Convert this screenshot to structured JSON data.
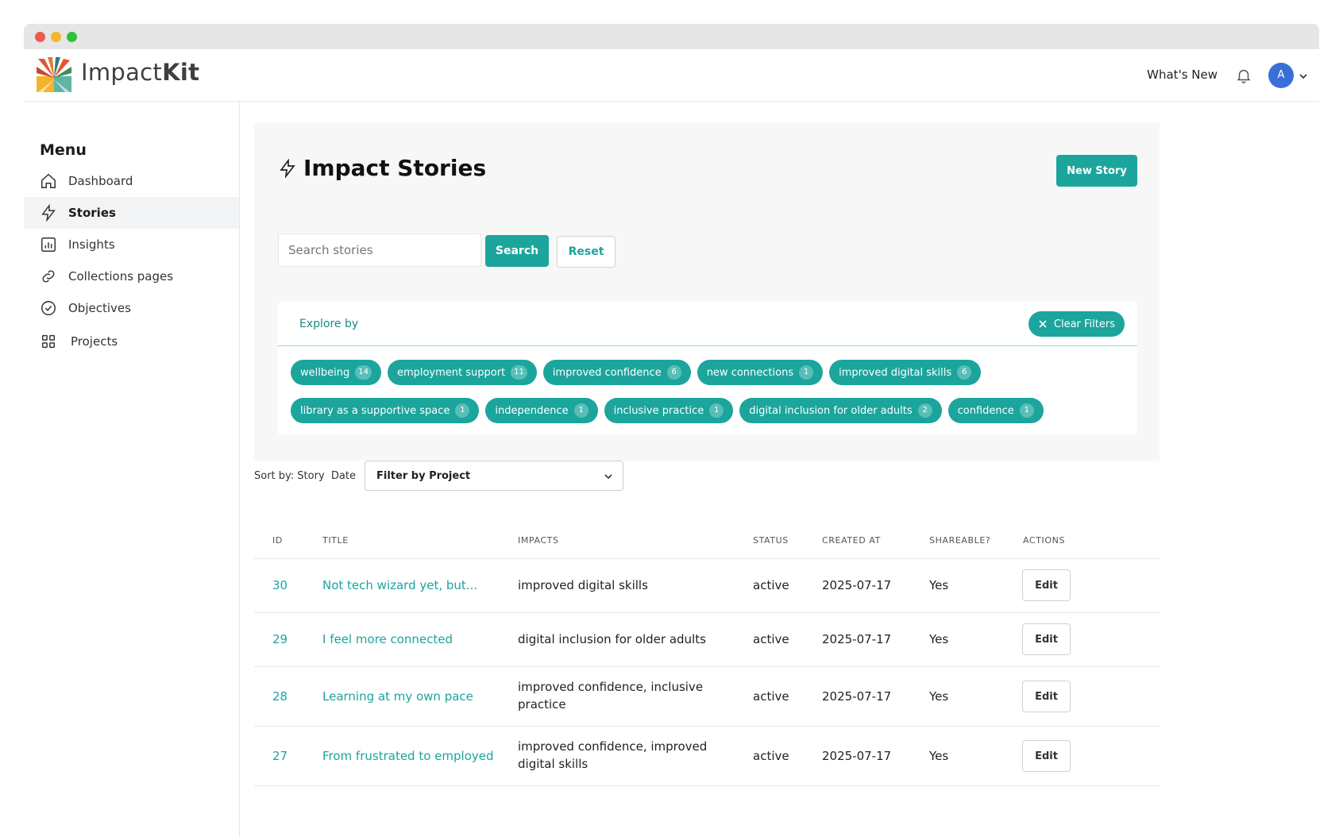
{
  "brand": {
    "name_light": "Impact",
    "name_bold": "Kit"
  },
  "header": {
    "whats_new": "What's New",
    "avatar_initials": "A"
  },
  "sidebar": {
    "title": "Menu",
    "items": [
      {
        "label": "Dashboard",
        "icon": "home-icon"
      },
      {
        "label": "Stories",
        "icon": "lightning-icon",
        "active": true
      },
      {
        "label": "Insights",
        "icon": "chart-icon"
      },
      {
        "label": "Collections pages",
        "icon": "link-icon"
      },
      {
        "label": "Objectives",
        "icon": "check-circle-icon"
      },
      {
        "label": "Projects",
        "icon": "grid-icon"
      }
    ]
  },
  "main": {
    "title": "Impact Stories",
    "new_story_label": "New Story",
    "search": {
      "placeholder": "Search stories",
      "button": "Search",
      "reset": "Reset"
    },
    "explore": {
      "label": "Explore by",
      "clear_label": "Clear Filters",
      "tags": [
        {
          "label": "wellbeing",
          "count": "14"
        },
        {
          "label": "employment support",
          "count": "11"
        },
        {
          "label": "improved confidence",
          "count": "6"
        },
        {
          "label": "new connections",
          "count": "1"
        },
        {
          "label": "improved digital skills",
          "count": "6"
        },
        {
          "label": "library as a supportive space",
          "count": "1"
        },
        {
          "label": "independence",
          "count": "1"
        },
        {
          "label": "inclusive practice",
          "count": "1"
        },
        {
          "label": "digital inclusion for older adults",
          "count": "2"
        },
        {
          "label": "confidence",
          "count": "1"
        }
      ]
    },
    "sort_label": "Sort by: Story  Date",
    "filter_label": "Filter by Project",
    "table": {
      "headers": [
        "ID",
        "TITLE",
        "IMPACTS",
        "STATUS",
        "CREATED AT",
        "SHAREABLE?",
        "ACTIONS"
      ],
      "rows": [
        {
          "id": "30",
          "title": "Not tech wizard yet, but...",
          "impacts": [
            "improved digital skills"
          ],
          "status": "active",
          "created": "2025-07-17",
          "shareable": "Yes",
          "action": "Edit"
        },
        {
          "id": "29",
          "title": "I feel more connected",
          "impacts": [
            "digital inclusion for older adults"
          ],
          "status": "active",
          "created": "2025-07-17",
          "shareable": "Yes",
          "action": "Edit"
        },
        {
          "id": "28",
          "title": "Learning at my own pace",
          "impacts": [
            "improved confidence, inclusive",
            "practice"
          ],
          "status": "active",
          "created": "2025-07-17",
          "shareable": "Yes",
          "action": "Edit"
        },
        {
          "id": "27",
          "title": "From frustrated to employed",
          "impacts": [
            "improved confidence, improved",
            "digital skills"
          ],
          "status": "active",
          "created": "2025-07-17",
          "shareable": "Yes",
          "action": "Edit"
        }
      ]
    }
  },
  "colors": {
    "accent": "#1ba59c",
    "accent_text": "#148e86"
  }
}
